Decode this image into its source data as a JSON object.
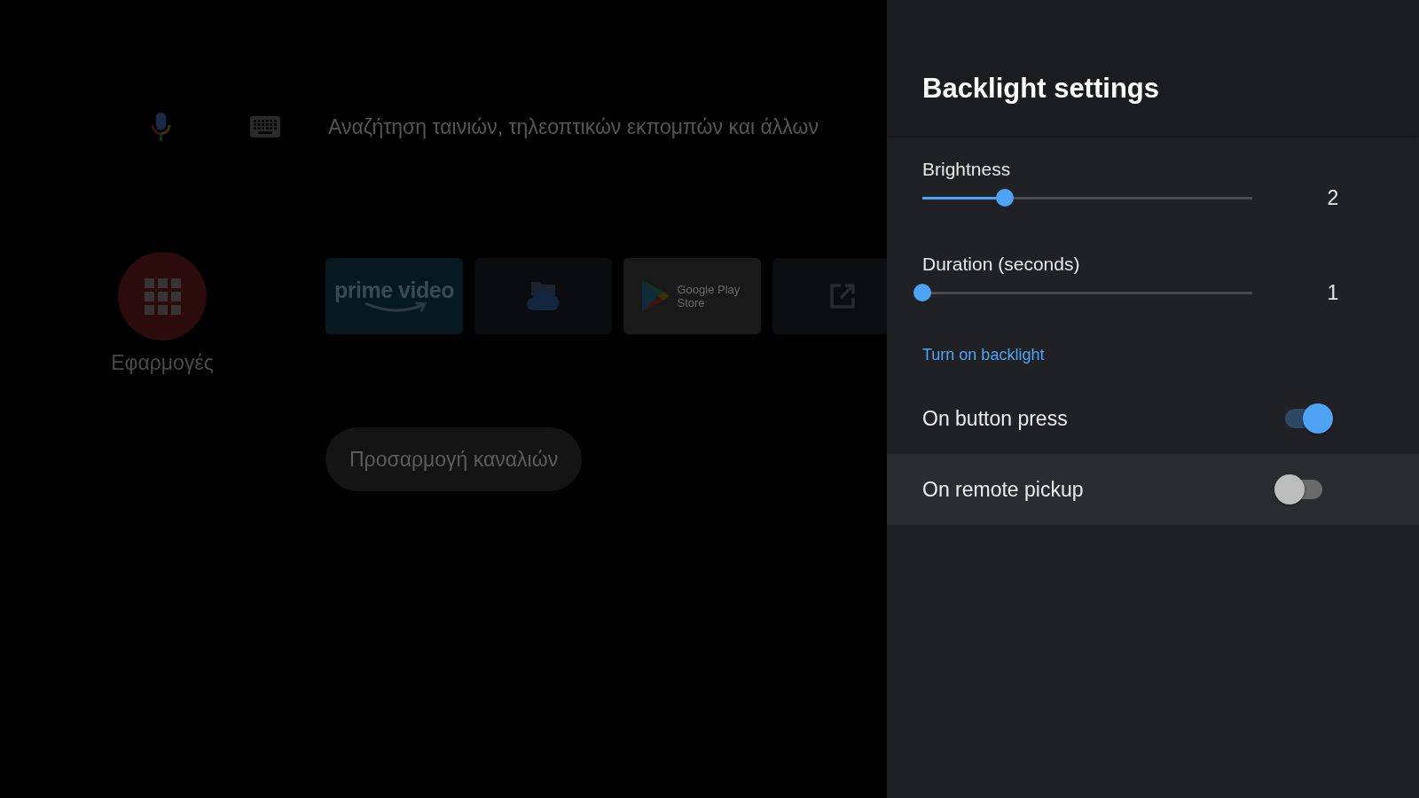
{
  "launcher": {
    "search": {
      "placeholder": "Αναζήτηση ταινιών, τηλεοπτικών εκπομπών και άλλων"
    },
    "apps": {
      "label": "Εφαρμογές"
    },
    "tiles": [
      {
        "kind": "prime",
        "label": "prime video"
      },
      {
        "kind": "cloud"
      },
      {
        "kind": "play",
        "label": "Google Play Store"
      },
      {
        "kind": "external"
      }
    ],
    "channels_button": {
      "label": "Προσαρμογή καναλιών"
    }
  },
  "panel": {
    "title": "Backlight settings",
    "sliders": [
      {
        "label": "Brightness",
        "level": 0.25,
        "reading": "2"
      },
      {
        "label": "Duration (seconds)",
        "level": 0,
        "reading": "1"
      }
    ],
    "section": "Turn on backlight",
    "toggles": [
      {
        "label": "On button press",
        "on": true,
        "selected": false
      },
      {
        "label": "On remote pickup",
        "on": false,
        "selected": true
      }
    ]
  }
}
